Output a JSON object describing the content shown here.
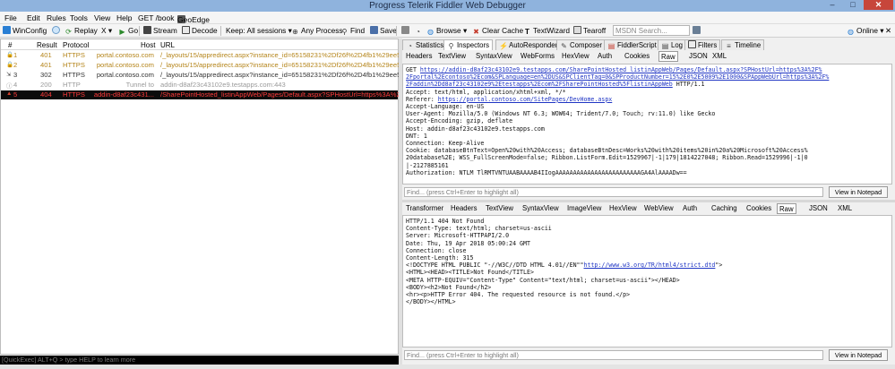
{
  "window": {
    "title": "Progress Telerik Fiddler Web Debugger",
    "min": "–",
    "max": "□",
    "close": "✕"
  },
  "menu": [
    "File",
    "Edit",
    "Rules",
    "Tools",
    "View",
    "Help",
    "GET /book",
    "GeoEdge"
  ],
  "toolbar": {
    "winconfig": "WinConfig",
    "replay": "Replay",
    "x_menu": "X ▾",
    "go": "Go",
    "stream": "Stream",
    "decode": "Decode",
    "keep": "Keep: All sessions ▾",
    "any_process": "Any Process",
    "find": "Find",
    "save": "Save",
    "browse": "Browse ▾",
    "clear_cache": "Clear Cache",
    "textwizard": "TextWizard",
    "tearoff": "Tearoff",
    "msdn_placeholder": "MSDN Search...",
    "online": "Online ▾",
    "close": "✕"
  },
  "sessions": {
    "columns": {
      "num": "#",
      "result": "Result",
      "protocol": "Protocol",
      "host": "Host",
      "url": "URL"
    },
    "rows": [
      {
        "num": "1",
        "result": "401",
        "protocol": "HTTPS",
        "host": "portal.contoso.com",
        "url": "/_layouts/15/appredirect.aspx?instance_id=65158231%2Df26f%2D4fb1%29ee5%2...",
        "style": "orange",
        "icon": "lock"
      },
      {
        "num": "2",
        "result": "401",
        "protocol": "HTTPS",
        "host": "portal.contoso.com",
        "url": "/_layouts/15/appredirect.aspx?instance_id=65158231%2Df26f%2D4fb1%29ee5%2...",
        "style": "orange",
        "icon": "lock"
      },
      {
        "num": "3",
        "result": "302",
        "protocol": "HTTPS",
        "host": "portal.contoso.com",
        "url": "/_layouts/15/appredirect.aspx?instance_id=65158231%2Df26f%2D4fb1%29ee5%2...",
        "style": "normal",
        "icon": "redirect"
      },
      {
        "num": "4",
        "result": "200",
        "protocol": "HTTP",
        "host": "Tunnel to",
        "url": "addin-d8af23c43102e9.testapps.com:443",
        "style": "gray",
        "icon": "tunnel"
      },
      {
        "num": "5",
        "result": "404",
        "protocol": "HTTPS",
        "host": "addin-d8af23c431...",
        "url": "/SharePointHosted_listinAppWeb/Pages/Default.aspx?SPHostUrl=https%3A%2F%2...",
        "style": "selected",
        "icon": "warning"
      }
    ]
  },
  "quickexec": "[QuickExec] ALT+Q > type HELP to learn more",
  "top_tabs": {
    "row1": [
      "Statistics",
      "Inspectors",
      "AutoResponder",
      "Composer",
      "FiddlerScript",
      "Log",
      "Filters",
      "Timeline"
    ],
    "active": "Inspectors"
  },
  "request_tabs": {
    "items": [
      "Headers",
      "TextView",
      "SyntaxView",
      "WebForms",
      "HexView",
      "Auth",
      "Cookies",
      "Raw",
      "JSON",
      "XML"
    ],
    "active": "Raw"
  },
  "request_raw": {
    "method": "GET",
    "url_line1": "https://addin-d8af23c43102e9.testapps.com/SharePointHosted_listinAppWeb/Pages/Default.aspx?SPHostUrl=https%3A%2F%",
    "url_line2": "2Fportal%2Econtoso%2Ecom&SPLanguage=en%2DUS&SPClientTag=0&SPProductNumber=15%2E0%2E5009%2E1000&SPAppWebUrl=https%3A%2F%",
    "url_line3": "2Faddin%2Dd8af23c43102e9%2Etestapps%2Ecom%2FSharePointHosted%5Flistin",
    "url_line3_tail": "AppWeb",
    "version": " HTTP/1.1",
    "lines_a": [
      "Accept: text/html, application/xhtml+xml, */*"
    ],
    "referer_label": "Referer: ",
    "referer_url": "https://portal.contoso.com/SitePages/DevHome.aspx",
    "lines_b": [
      "Accept-Language: en-US",
      "User-Agent: Mozilla/5.0 (Windows NT 6.3; WOW64; Trident/7.0; Touch; rv:11.0) like Gecko",
      "Accept-Encoding: gzip, deflate",
      "Host: addin-d8af23c43102e9.testapps.com",
      "DNT: 1",
      "Connection: Keep-Alive",
      "Cookie: databaseBtnText=Open%20with%20Access; databaseBtnDesc=Works%20with%20items%20in%20a%20Microsoft%20Access%",
      "20database%2E; WSS_FullScreenMode=false; Ribbon.ListForm.Edit=1529967|-1|179|1814227048; Ribbon.Read=1529996|-1|0",
      "|-2127885161",
      "Authorization: NTLM TlRMTVNTUAABAAAAB4IIogAAAAAAAAAAAAAAAAAAAAAAAAGA4AlAAAADw=="
    ]
  },
  "request_find": {
    "placeholder": "Find... (press Ctrl+Enter to highlight all)",
    "button": "View in Notepad"
  },
  "response_tabs": {
    "items": [
      "Transformer",
      "Headers",
      "TextView",
      "SyntaxView",
      "ImageView",
      "HexView",
      "WebView",
      "Auth",
      "Caching",
      "Cookies",
      "Raw",
      "JSON",
      "XML"
    ],
    "active": "Raw"
  },
  "response_raw": {
    "lines_a": [
      "HTTP/1.1 404 Not Found",
      "Content-Type: text/html; charset=us-ascii",
      "Server: Microsoft-HTTPAPI/2.0",
      "Date: Thu, 19 Apr 2018 05:00:24 GMT",
      "Connection: close",
      "Content-Length: 315",
      ""
    ],
    "doctype_prefix": "<!DOCTYPE HTML PUBLIC \"-//W3C//DTD HTML 4.01//EN\"\"",
    "doctype_url": "http://www.w3.org/TR/html4/strict.dtd",
    "doctype_suffix": "\">",
    "lines_b": [
      "<HTML><HEAD><TITLE>Not Found</TITLE>",
      "<META HTTP-EQUIV=\"Content-Type\" Content=\"text/html; charset=us-ascii\"></HEAD>",
      "<BODY><h2>Not Found</h2>",
      "<hr><p>HTTP Error 404. The requested resource is not found.</p>",
      "</BODY></HTML>"
    ]
  },
  "response_find": {
    "placeholder": "Find... (press Ctrl+Enter to highlight all)",
    "button": "View in Notepad"
  },
  "colors": {
    "titlebar": "#8fb3dd",
    "selected_row_bg": "#0b0b0b",
    "selected_row_fg": "#ff3b3b",
    "warning_row": "#b5851b",
    "link": "#1f35c4"
  }
}
